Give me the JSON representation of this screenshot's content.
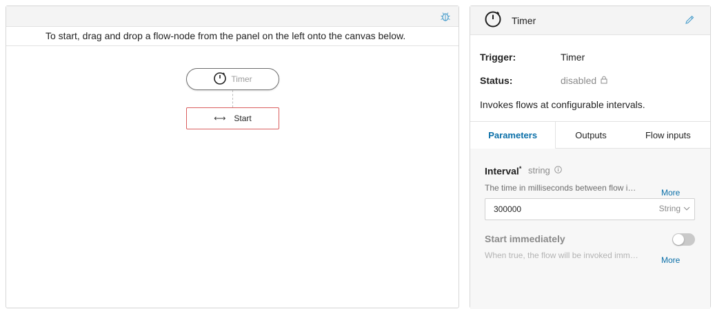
{
  "canvas": {
    "instructions": "To start, drag and drop a flow-node from the panel on the left onto the canvas below.",
    "debug_icon": "bug-icon",
    "trigger_node": {
      "label": "Timer",
      "icon": "stopwatch-icon"
    },
    "start_node": {
      "label": "Start",
      "icon": "arrows-horizontal-icon",
      "glyph": "⟷"
    }
  },
  "panel": {
    "title": "Timer",
    "title_icon": "stopwatch-icon",
    "edit_icon": "pencil-icon",
    "trigger_label": "Trigger:",
    "trigger_value": "Timer",
    "status_label": "Status:",
    "status_value": "disabled",
    "status_icon": "lock-icon",
    "description": "Invokes flows at configurable intervals.",
    "tabs": [
      {
        "label": "Parameters",
        "active": true
      },
      {
        "label": "Outputs",
        "active": false
      },
      {
        "label": "Flow inputs",
        "active": false
      }
    ],
    "parameters": {
      "interval": {
        "name": "Interval",
        "required_mark": "*",
        "type": "string",
        "info_icon": "info-icon",
        "description": "The time in milliseconds between flow invocations.",
        "more_label": "More",
        "value": "300000",
        "type_select": "String",
        "type_select_icon": "chevron-down-icon"
      },
      "start_immediately": {
        "name": "Start immediately",
        "enabled": false,
        "description": "When true, the flow will be invoked immediately.",
        "more_label": "More"
      }
    }
  },
  "colors": {
    "accent": "#0a6fa8",
    "node_border_error": "#d95c5c",
    "toolbar_bg": "#f4f4f4",
    "muted_text": "#8a8a8a"
  }
}
